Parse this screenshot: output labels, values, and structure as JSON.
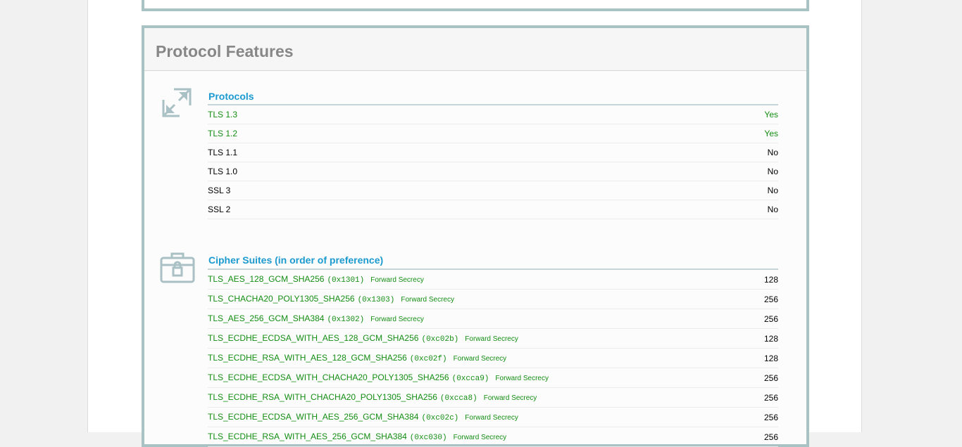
{
  "section": {
    "title": "Protocol Features"
  },
  "protocols": {
    "title": "Protocols",
    "icon": "arrows-expand-icon",
    "rows": [
      {
        "name": "TLS 1.3",
        "value": "Yes",
        "ok": true
      },
      {
        "name": "TLS 1.2",
        "value": "Yes",
        "ok": true
      },
      {
        "name": "TLS 1.1",
        "value": "No",
        "ok": false
      },
      {
        "name": "TLS 1.0",
        "value": "No",
        "ok": false
      },
      {
        "name": "SSL 3",
        "value": "No",
        "ok": false
      },
      {
        "name": "SSL 2",
        "value": "No",
        "ok": false
      }
    ]
  },
  "ciphers": {
    "title": "Cipher Suites (in order of preference)",
    "icon": "lock-briefcase-icon",
    "rows": [
      {
        "name": "TLS_AES_128_GCM_SHA256",
        "code": "(0x1301)",
        "fs": "Forward Secrecy",
        "bits": "128"
      },
      {
        "name": "TLS_CHACHA20_POLY1305_SHA256",
        "code": "(0x1303)",
        "fs": "Forward Secrecy",
        "bits": "256"
      },
      {
        "name": "TLS_AES_256_GCM_SHA384",
        "code": "(0x1302)",
        "fs": "Forward Secrecy",
        "bits": "256"
      },
      {
        "name": "TLS_ECDHE_ECDSA_WITH_AES_128_GCM_SHA256",
        "code": "(0xc02b)",
        "fs": "Forward Secrecy",
        "bits": "128"
      },
      {
        "name": "TLS_ECDHE_RSA_WITH_AES_128_GCM_SHA256",
        "code": "(0xc02f)",
        "fs": "Forward Secrecy",
        "bits": "128"
      },
      {
        "name": "TLS_ECDHE_ECDSA_WITH_CHACHA20_POLY1305_SHA256",
        "code": "(0xcca9)",
        "fs": "Forward Secrecy",
        "bits": "256"
      },
      {
        "name": "TLS_ECDHE_RSA_WITH_CHACHA20_POLY1305_SHA256",
        "code": "(0xcca8)",
        "fs": "Forward Secrecy",
        "bits": "256"
      },
      {
        "name": "TLS_ECDHE_ECDSA_WITH_AES_256_GCM_SHA384",
        "code": "(0xc02c)",
        "fs": "Forward Secrecy",
        "bits": "256"
      },
      {
        "name": "TLS_ECDHE_RSA_WITH_AES_256_GCM_SHA384",
        "code": "(0xc030)",
        "fs": "Forward Secrecy",
        "bits": "256"
      }
    ]
  },
  "colors": {
    "accent": "#1a9acf",
    "ok": "#138d13",
    "border": "#a9c2c4"
  }
}
